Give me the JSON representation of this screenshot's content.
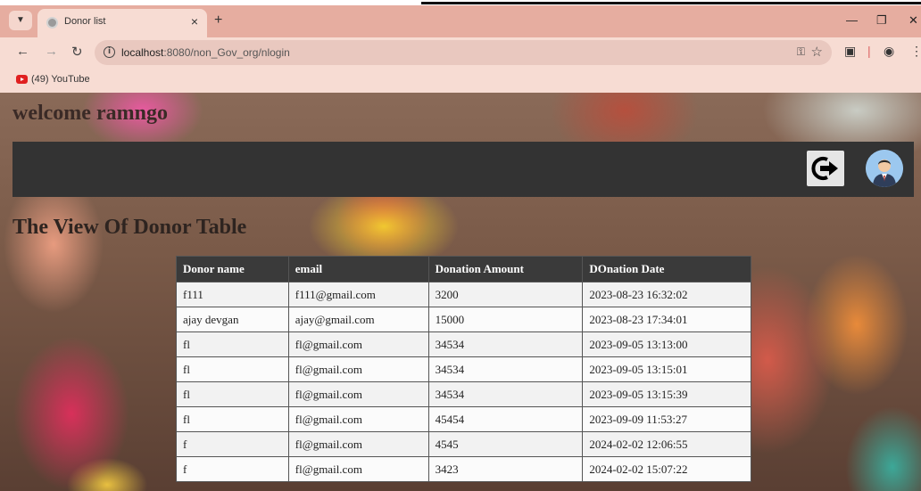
{
  "browser": {
    "tab_title": "Donor list",
    "tab_close": "×",
    "new_tab": "+",
    "url_host": "localhost",
    "url_path": ":8080/non_Gov_org/nlogin",
    "bookmark_label": "(49) YouTube"
  },
  "page": {
    "welcome": "welcome ramngo",
    "section_title": "The View Of Donor Table"
  },
  "table": {
    "headers": [
      "Donor name",
      "email",
      "Donation Amount",
      "DOnation Date"
    ],
    "rows": [
      [
        "f111",
        "f111@gmail.com",
        "3200",
        "2023-08-23 16:32:02"
      ],
      [
        "ajay devgan",
        "ajay@gmail.com",
        "15000",
        "2023-08-23 17:34:01"
      ],
      [
        "fl",
        "fl@gmail.com",
        "34534",
        "2023-09-05 13:13:00"
      ],
      [
        "fl",
        "fl@gmail.com",
        "34534",
        "2023-09-05 13:15:01"
      ],
      [
        "fl",
        "fl@gmail.com",
        "34534",
        "2023-09-05 13:15:39"
      ],
      [
        "fl",
        "fl@gmail.com",
        "45454",
        "2023-09-09 11:53:27"
      ],
      [
        "f",
        "fl@gmail.com",
        "4545",
        "2024-02-02 12:06:55"
      ],
      [
        "f",
        "fl@gmail.com",
        "3423",
        "2024-02-02 15:07:22"
      ]
    ]
  },
  "icons": {
    "logout": "logout-icon",
    "profile": "user-avatar-icon"
  },
  "colors": {
    "navbar": "#333333",
    "table_header": "#3a3a3a",
    "tab_strip": "#e6ada0",
    "toolbar": "#f7dcd3"
  }
}
